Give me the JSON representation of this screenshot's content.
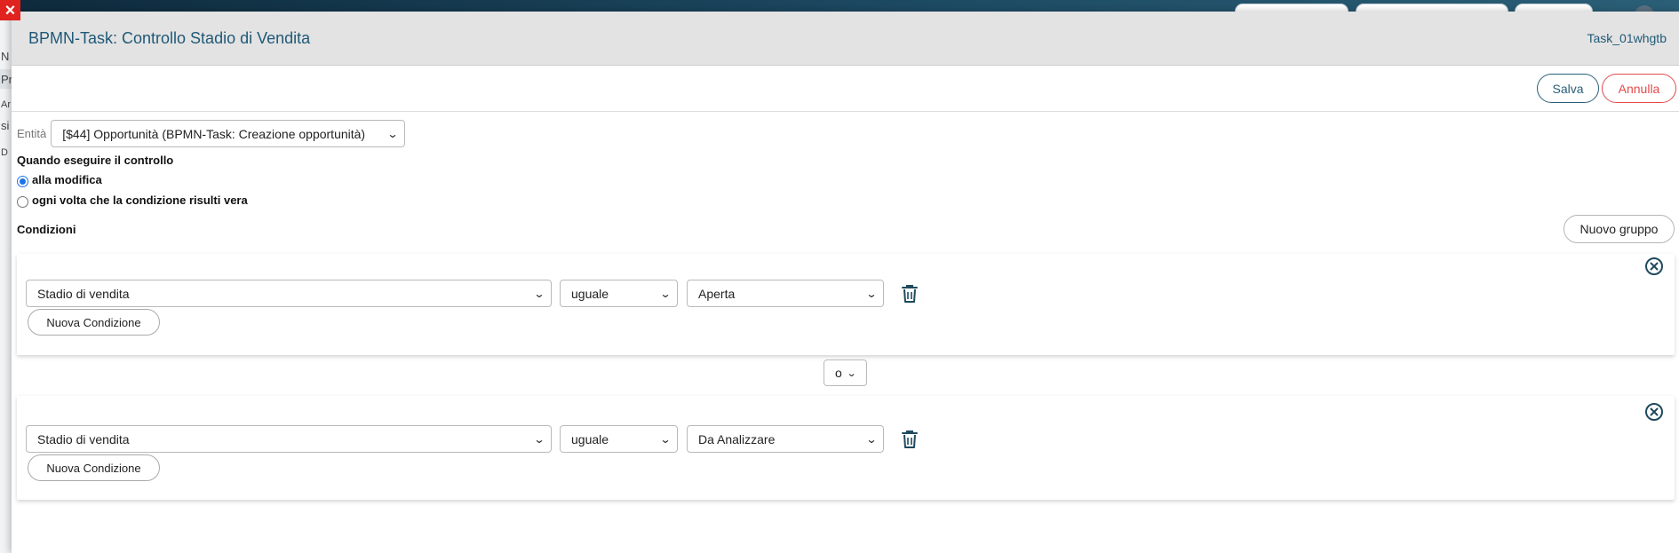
{
  "background": {
    "close_icon": "×",
    "sidebar_letters": [
      "N",
      "Pr",
      "Ar",
      "si",
      "D"
    ]
  },
  "modal": {
    "title": "BPMN-Task: Controllo Stadio di Vendita",
    "task_id": "Task_01whgtb",
    "save_label": "Salva",
    "cancel_label": "Annulla"
  },
  "entity": {
    "label": "Entità",
    "value": "[$44] Opportunità (BPMN-Task: Creazione opportunità)"
  },
  "when": {
    "title": "Quando eseguire il controllo",
    "options": [
      {
        "label": "alla modifica",
        "checked": true
      },
      {
        "label": "ogni volta che la condizione risulti vera",
        "checked": false
      }
    ]
  },
  "conditions": {
    "title": "Condizioni",
    "new_group_label": "Nuovo gruppo",
    "connector": "o",
    "groups": [
      {
        "field": "Stadio di vendita",
        "operator": "uguale",
        "value": "Aperta",
        "new_condition_label": "Nuova Condizione"
      },
      {
        "field": "Stadio di vendita",
        "operator": "uguale",
        "value": "Da Analizzare",
        "new_condition_label": "Nuova Condizione"
      }
    ]
  },
  "colors": {
    "title": "#1f5977",
    "save": "#2a5e78",
    "cancel": "#e34b4b",
    "radio_checked": "#1a73e8",
    "close": "#e0231f"
  }
}
